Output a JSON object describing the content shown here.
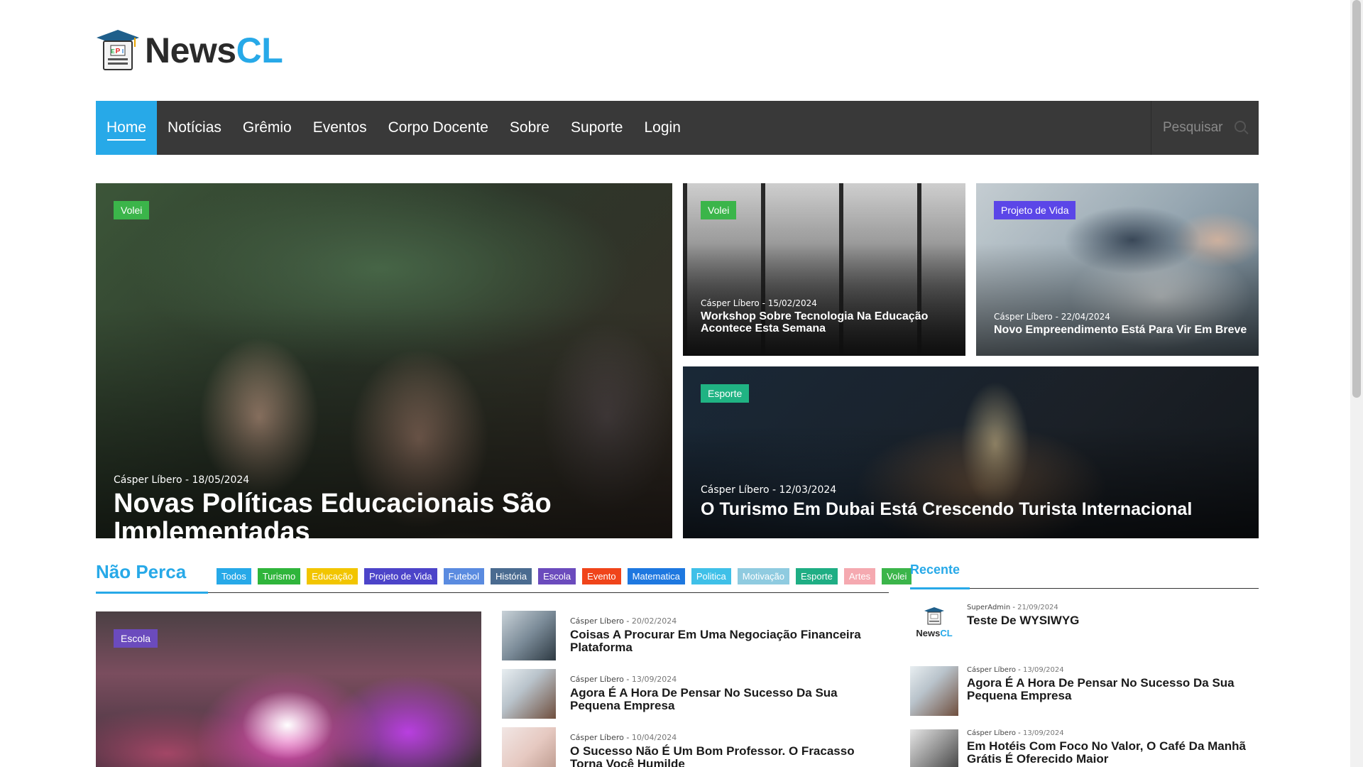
{
  "logo": {
    "text_a": "News",
    "text_b": "CL",
    "badge_text": "PEI"
  },
  "nav": {
    "items": [
      "Home",
      "Notícias",
      "Grêmio",
      "Eventos",
      "Corpo Docente",
      "Sobre",
      "Suporte",
      "Login"
    ],
    "active": "Home",
    "search_placeholder": "Pesquisar"
  },
  "hero": {
    "main": {
      "tag": "Volei",
      "tag_color": "#3bb54a",
      "author": "Cásper Líbero",
      "date": "18/05/2024",
      "title": "Novas Políticas Educacionais São Implementadas"
    },
    "top_mid": {
      "tag": "Volei",
      "tag_color": "#3bb54a",
      "author": "Cásper Líbero",
      "date": "15/02/2024",
      "title": "Workshop Sobre Tecnologia Na Educação Acontece Esta Semana"
    },
    "top_right": {
      "tag": "Projeto de Vida",
      "tag_color": "#5b46e8",
      "author": "Cásper Líbero",
      "date": "22/04/2024",
      "title": "Novo Empreendimento Está Para Vir Em Breve"
    },
    "bottom_wide": {
      "tag": "Esporte",
      "tag_color": "#20b383",
      "author": "Cásper Líbero",
      "date": "12/03/2024",
      "title": "O Turismo Em Dubai Está Crescendo Turista Internacional"
    }
  },
  "nao_perca": {
    "title": "Não Perca",
    "filters": [
      {
        "label": "Todos",
        "color": "#27a9e8"
      },
      {
        "label": "Turismo",
        "color": "#2fb53b"
      },
      {
        "label": "Educação",
        "color": "#f2c500"
      },
      {
        "label": "Projeto de Vida",
        "color": "#4c44c9"
      },
      {
        "label": "Futebol",
        "color": "#5a8be0"
      },
      {
        "label": "História",
        "color": "#4a6b90"
      },
      {
        "label": "Escola",
        "color": "#6b4bbd"
      },
      {
        "label": "Evento",
        "color": "#f0441a"
      },
      {
        "label": "Matematica",
        "color": "#1e78e0"
      },
      {
        "label": "Politica",
        "color": "#3fc0e8"
      },
      {
        "label": "Motivação",
        "color": "#8fcbe0"
      },
      {
        "label": "Esporte",
        "color": "#1fae84"
      },
      {
        "label": "Artes",
        "color": "#f5a9b0"
      },
      {
        "label": "Volei",
        "color": "#3bb54a"
      }
    ],
    "feature": {
      "tag": "Escola",
      "tag_color": "#6b4bbd"
    },
    "list": [
      {
        "author": "Cásper Líbero",
        "date": "20/02/2024",
        "title": "Coisas A Procurar Em Uma Negociação Financeira Plataforma"
      },
      {
        "author": "Cásper Líbero",
        "date": "13/09/2024",
        "title": "Agora É A Hora De Pensar No Sucesso Da Sua Pequena Empresa"
      },
      {
        "author": "Cásper Líbero",
        "date": "10/04/2024",
        "title": "O Sucesso Não É Um Bom Professor. O Fracasso Torna Você Humilde"
      }
    ]
  },
  "recent": {
    "title": "Recente",
    "items": [
      {
        "author": "SuperAdmin",
        "date": "21/09/2024",
        "title": "Teste De WYSIWYG"
      },
      {
        "author": "Cásper Líbero",
        "date": "13/09/2024",
        "title": "Agora É A Hora De Pensar No Sucesso Da Sua Pequena Empresa"
      },
      {
        "author": "Cásper Líbero",
        "date": "13/09/2024",
        "title": "Em Hotéis Com Foco No Valor, O Café Da Manhã Grátis É Oferecido Maior"
      }
    ]
  }
}
